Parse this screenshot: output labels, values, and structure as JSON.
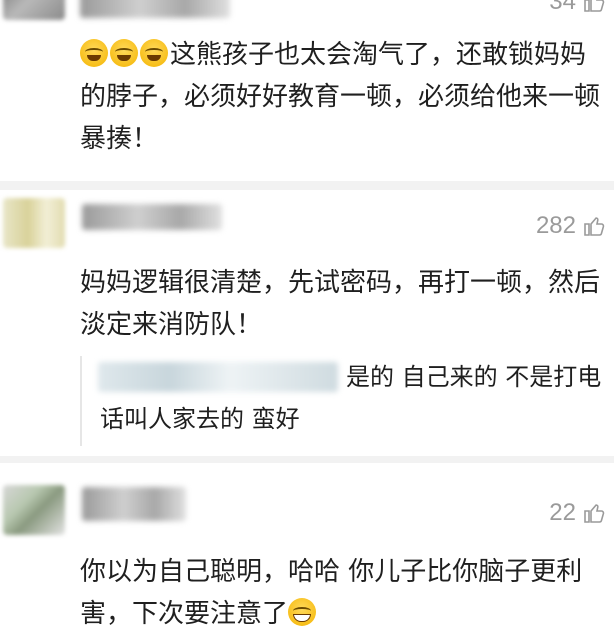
{
  "comments": [
    {
      "likes": "34",
      "text_lines": [
        "这熊孩子也太会淘气了，还敢锁妈妈",
        "的脖子，必须好好教育一顿，必须给他来一顿",
        "暴揍！"
      ],
      "emoji": "laughing-crying-emoji"
    },
    {
      "likes": "282",
      "text_lines": [
        "妈妈逻辑很清楚，先试密码，再打一顿，然后",
        "淡定来消防队！"
      ],
      "reply": {
        "text_lines": [
          "是的 自己来的 不是打电",
          "话叫人家去的 蛮好"
        ]
      }
    },
    {
      "likes": "22",
      "text_lines": [
        "你以为自己聪明，哈哈 你儿子比你脑子更利",
        "害，下次要注意了"
      ],
      "emoji": "grinning-emoji"
    }
  ],
  "colors": {
    "background": "#f2f2f2",
    "card": "#ffffff",
    "text": "#1f1f1f",
    "muted": "#9a9a9a"
  },
  "icons": {
    "like": "thumbs-up-icon"
  }
}
